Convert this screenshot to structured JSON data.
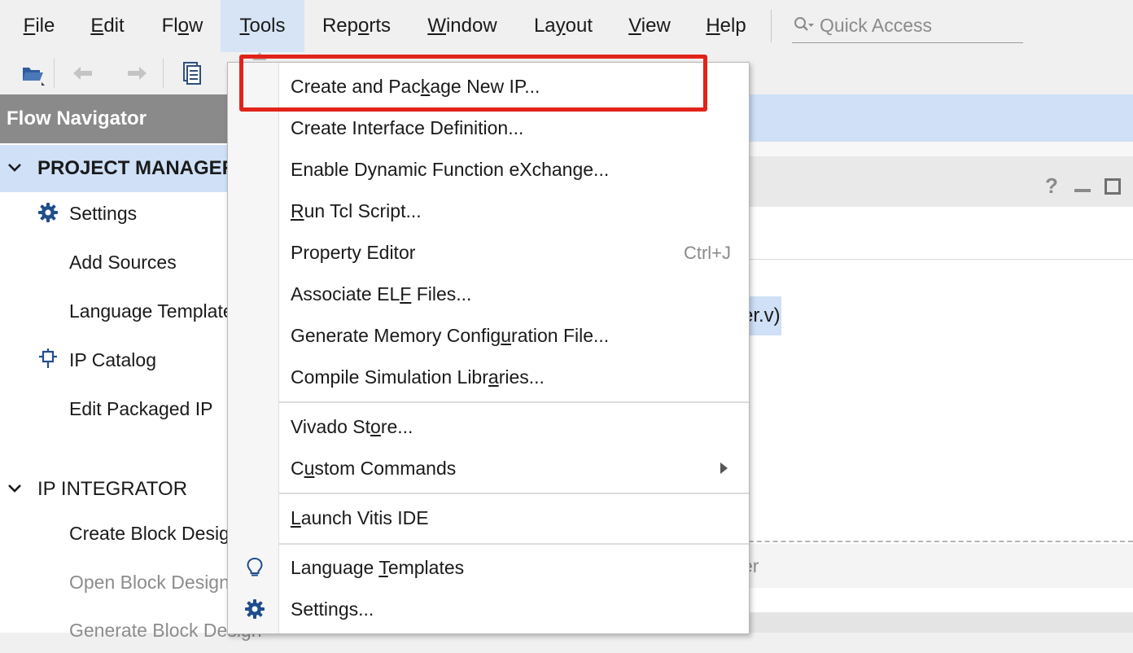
{
  "menubar": {
    "items": [
      {
        "pre": "",
        "u": "F",
        "post": "ile"
      },
      {
        "pre": "",
        "u": "E",
        "post": "dit"
      },
      {
        "pre": "Fl",
        "u": "o",
        "post": "w"
      },
      {
        "pre": "",
        "u": "T",
        "post": "ools"
      },
      {
        "pre": "Rep",
        "u": "o",
        "post": "rts"
      },
      {
        "pre": "",
        "u": "W",
        "post": "indow"
      },
      {
        "pre": "La",
        "u": "y",
        "post": "out"
      },
      {
        "pre": "",
        "u": "V",
        "post": "iew"
      },
      {
        "pre": "",
        "u": "H",
        "post": "elp"
      }
    ],
    "quick_access_placeholder": "Quick Access"
  },
  "toolbar": {
    "icons": [
      "open-project-icon",
      "undo-icon",
      "redo-icon",
      "report-icon"
    ]
  },
  "flow_navigator": {
    "title": "Flow Navigator",
    "project_manager": {
      "label": "PROJECT MANAGER",
      "items": [
        "Settings",
        "Add Sources",
        "Language Templates",
        "IP Catalog",
        "Edit Packaged IP"
      ]
    },
    "ip_integrator": {
      "label": "IP INTEGRATOR",
      "items": [
        "Create Block Design",
        "Open Block Design",
        "Generate Block Design"
      ]
    }
  },
  "workspace": {
    "highlighted_fragment": "er.v)",
    "lower_fragment": "er"
  },
  "tools_menu": {
    "items": [
      {
        "pre": "Create and Pac",
        "u": "k",
        "post": "age New IP..."
      },
      {
        "pre": "Create Interface Definition...",
        "u": "",
        "post": ""
      },
      {
        "pre": "Enable Dynamic Function eXchange...",
        "u": "",
        "post": ""
      },
      {
        "pre": "",
        "u": "R",
        "post": "un Tcl Script..."
      },
      {
        "pre": "Property Editor",
        "u": "",
        "post": "",
        "shortcut": "Ctrl+J"
      },
      {
        "pre": "Associate EL",
        "u": "F",
        "post": " Files..."
      },
      {
        "pre": "Generate Memory Config",
        "u": "u",
        "post": "ration File..."
      },
      {
        "pre": "Compile Simulation Libr",
        "u": "a",
        "post": "ries..."
      },
      {
        "pre": "Vivado St",
        "u": "o",
        "post": "re..."
      },
      {
        "pre": "C",
        "u": "u",
        "post": "stom Commands"
      },
      {
        "pre": "",
        "u": "L",
        "post": "aunch Vitis IDE"
      },
      {
        "pre": "Language ",
        "u": "T",
        "post": "emplates"
      },
      {
        "pre": "Settings...",
        "u": "",
        "post": ""
      }
    ]
  },
  "colors": {
    "highlight_box": "#e2231a",
    "selection_blue": "#cfe0f7",
    "nav_header": "#8a8a8a",
    "icon_blue": "#1f4e8c"
  }
}
